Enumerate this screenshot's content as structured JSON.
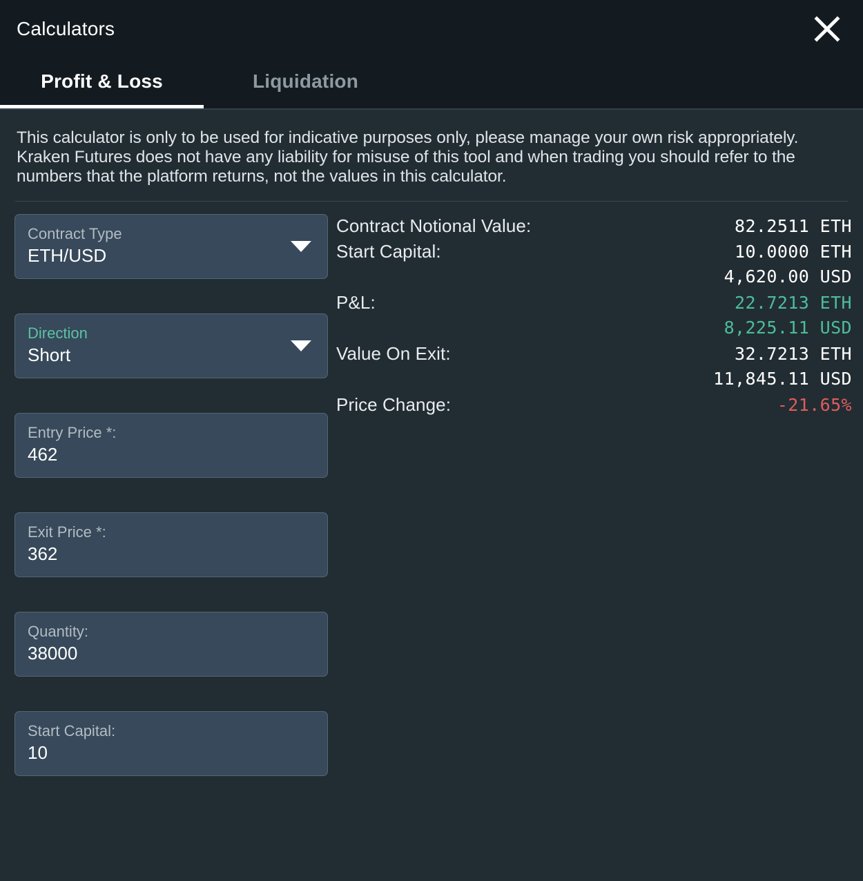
{
  "window": {
    "title": "Calculators",
    "close_icon": "close-icon"
  },
  "tabs": [
    {
      "label": "Profit & Loss",
      "active": true
    },
    {
      "label": "Liquidation",
      "active": false
    }
  ],
  "disclaimer": "This calculator is only to be used for indicative purposes only, please manage your own risk appropriately. Kraken Futures does not have any liability for misuse of this tool and when trading you should refer to the numbers that the platform returns, not the values in this calculator.",
  "form": {
    "fields": [
      {
        "name": "contract-type",
        "label": "Contract Type",
        "value": "ETH/USD",
        "type": "select",
        "label_accent": false,
        "caret_icon": "chevron-down-icon"
      },
      {
        "name": "direction",
        "label": "Direction",
        "value": "Short",
        "type": "select",
        "label_accent": true,
        "caret_icon": "chevron-down-icon"
      },
      {
        "name": "entry-price",
        "label": "Entry Price *:",
        "value": "462",
        "type": "text",
        "label_accent": false
      },
      {
        "name": "exit-price",
        "label": "Exit Price *:",
        "value": "362",
        "type": "text",
        "label_accent": false
      },
      {
        "name": "quantity",
        "label": "Quantity:",
        "value": "38000",
        "type": "text",
        "label_accent": false
      },
      {
        "name": "start-capital",
        "label": "Start Capital:",
        "value": "10",
        "type": "text",
        "label_accent": false
      }
    ]
  },
  "results": {
    "rows": [
      {
        "name": "contract-notional-value",
        "label": "Contract Notional Value:",
        "value": "82.2511 ETH",
        "tone": "neutral"
      },
      {
        "name": "start-capital-eth",
        "label": "Start Capital:",
        "value": "10.0000 ETH",
        "tone": "neutral"
      },
      {
        "name": "start-capital-usd",
        "label": "",
        "value": "4,620.00 USD",
        "tone": "neutral"
      },
      {
        "name": "pnl-eth",
        "label": "P&L:",
        "value": "22.7213 ETH",
        "tone": "positive"
      },
      {
        "name": "pnl-usd",
        "label": "",
        "value": "8,225.11 USD",
        "tone": "positive"
      },
      {
        "name": "value-on-exit-eth",
        "label": "Value On Exit:",
        "value": "32.7213 ETH",
        "tone": "neutral"
      },
      {
        "name": "value-on-exit-usd",
        "label": "",
        "value": "11,845.11 USD",
        "tone": "neutral"
      },
      {
        "name": "price-change",
        "label": "Price Change:",
        "value": "-21.65%",
        "tone": "negative"
      }
    ]
  },
  "colors": {
    "window_bg": "#222d33",
    "header_bg": "#141b20",
    "field_bg": "#37495a",
    "field_border": "#556775",
    "accent_teal": "#5cc2a5",
    "positive": "#4dbd9c",
    "negative": "#e05c5c",
    "text_primary": "#ffffff",
    "text_muted": "#b3bcc3",
    "tab_inactive": "#8e9aa2"
  }
}
